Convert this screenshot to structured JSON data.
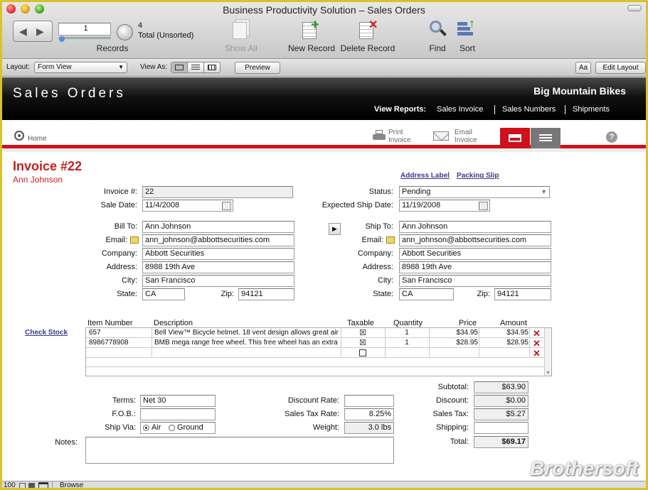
{
  "window": {
    "title": "Business Productivity Solution – Sales Orders"
  },
  "toolbar": {
    "record_number": "1",
    "record_count": "4",
    "record_status": "Total (Unsorted)",
    "records_label": "Records",
    "show_all": "Show All",
    "new_record": "New Record",
    "delete_record": "Delete Record",
    "find": "Find",
    "sort": "Sort"
  },
  "layoutbar": {
    "layout_label": "Layout:",
    "layout_value": "Form View",
    "view_as_label": "View As:",
    "preview": "Preview",
    "aa": "Aa",
    "edit_layout": "Edit Layout"
  },
  "header": {
    "title": "Sales Orders",
    "company": "Big Mountain Bikes",
    "view_reports_label": "View Reports:",
    "reports": [
      "Sales Invoice",
      "Sales Numbers",
      "Shipments"
    ]
  },
  "nav": {
    "home": "Home",
    "print_invoice": [
      "Print",
      "Invoice"
    ],
    "email_invoice": [
      "Email",
      "Invoice"
    ],
    "help": "?"
  },
  "invoice": {
    "title": "Invoice #22",
    "customer": "Ann Johnson",
    "address_label_link": "Address Label",
    "packing_slip_link": "Packing Slip",
    "check_stock_link": "Check Stock",
    "labels": {
      "invoice_no": "Invoice #:",
      "sale_date": "Sale Date:",
      "status": "Status:",
      "expected_ship": "Expected Ship Date:",
      "bill_to": "Bill To:",
      "ship_to": "Ship To:",
      "email": "Email:",
      "company": "Company:",
      "address": "Address:",
      "city": "City:",
      "state": "State:",
      "zip": "Zip:"
    },
    "invoice_no": "22",
    "sale_date": "11/4/2008",
    "status": "Pending",
    "expected_ship_date": "11/19/2008",
    "bill": {
      "name": "Ann Johnson",
      "email": "ann_johnson@abbottsecurities.com",
      "company": "Abbott Securities",
      "address": "8988 19th Ave",
      "city": "San Francisco",
      "state": "CA",
      "zip": "94121"
    },
    "ship": {
      "name": "Ann Johnson",
      "email": "ann_johnson@abbottsecurities.com",
      "company": "Abbott Securities",
      "address": "8988 19th Ave",
      "city": "San Francisco",
      "state": "CA",
      "zip": "94121"
    }
  },
  "items": {
    "columns": [
      "Item Number",
      "Description",
      "Taxable",
      "Quantity",
      "Price",
      "Amount"
    ],
    "rows": [
      {
        "item": "657",
        "desc": "Bell View™ Bicycle helmet. 18 vent design allows great air",
        "taxable": "☒",
        "qty": "1",
        "price": "$34.95",
        "amount": "$34.95"
      },
      {
        "item": "8986778908",
        "desc": "BMB mega range free wheel. This free wheel has an extra",
        "taxable": "☒",
        "qty": "1",
        "price": "$28.95",
        "amount": "$28.95"
      }
    ]
  },
  "terms": {
    "terms_label": "Terms:",
    "terms_value": "Net 30",
    "fob_label": "F.O.B.:",
    "fob_value": "",
    "ship_via_label": "Ship Via:",
    "air": "Air",
    "ground": "Ground",
    "notes_label": "Notes:",
    "discount_rate_label": "Discount Rate:",
    "discount_rate_value": "",
    "sales_tax_rate_label": "Sales Tax Rate:",
    "sales_tax_rate_value": "8.25%",
    "weight_label": "Weight:",
    "weight_value": "3.0 lbs"
  },
  "totals": {
    "subtotal_label": "Subtotal:",
    "subtotal": "$63.90",
    "discount_label": "Discount:",
    "discount": "$0.00",
    "sales_tax_label": "Sales Tax:",
    "sales_tax": "$5.27",
    "shipping_label": "Shipping:",
    "shipping": "",
    "total_label": "Total:",
    "total": "$69.17"
  },
  "statusbar": {
    "zoom": "100",
    "mode": "Browse"
  },
  "watermark": "Brothersoft",
  "colors": {
    "accent_red": "#c81e1e",
    "link": "#3a3a8c"
  }
}
